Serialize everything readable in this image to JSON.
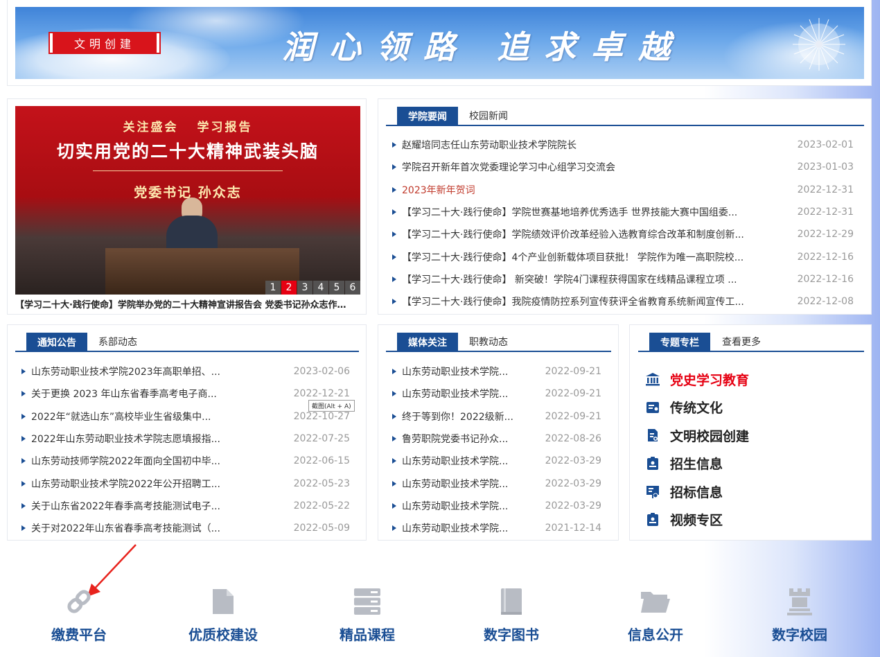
{
  "banner": {
    "badge": "文明创建",
    "slogan": "润心领路 追求卓越"
  },
  "slideshow": {
    "subtitle": "关注盛会 学习报告",
    "title": "切实用党的二十大精神武装头脑",
    "speaker": "党委书记 孙众志",
    "pages": [
      "1",
      "2",
      "3",
      "4",
      "5",
      "6"
    ],
    "active_page": "2",
    "caption": "【学习二十大·践行使命】学院举办党的二十大精神宣讲报告会 党委书记孙众志作专题..."
  },
  "college_news": {
    "tab_active": "学院要闻",
    "tab_other": "校园新闻",
    "items": [
      {
        "title": "赵耀培同志任山东劳动职业技术学院院长",
        "date": "2023-02-01"
      },
      {
        "title": "学院召开新年首次党委理论学习中心组学习交流会",
        "date": "2023-01-03"
      },
      {
        "title": "2023年新年贺词",
        "date": "2022-12-31"
      },
      {
        "title": "【学习二十大·践行使命】学院世赛基地培养优秀选手 世界技能大赛中国组委...",
        "date": "2022-12-31"
      },
      {
        "title": "【学习二十大·践行使命】学院绩效评价改革经验入选教育综合改革和制度创新...",
        "date": "2022-12-29"
      },
      {
        "title": "【学习二十大·践行使命】4个产业创新载体项目获批！ 学院作为唯一高职院校...",
        "date": "2022-12-16"
      },
      {
        "title": "【学习二十大·践行使命】 新突破！学院4门课程获得国家在线精品课程立项 ...",
        "date": "2022-12-16"
      },
      {
        "title": "【学习二十大·践行使命】我院疫情防控系列宣传获评全省教育系统新闻宣传工...",
        "date": "2022-12-08"
      }
    ]
  },
  "notices": {
    "tab_active": "通知公告",
    "tab_other": "系部动态",
    "items": [
      {
        "title": "山东劳动职业技术学院2023年高职单招、...",
        "date": "2023-02-06"
      },
      {
        "title": "关于更换 2023 年山东省春季高考电子商...",
        "date": "2022-12-21"
      },
      {
        "title": "2022年“就选山东”高校毕业生省级集中...",
        "date": "2022-10-27"
      },
      {
        "title": "2022年山东劳动职业技术学院志愿填报指...",
        "date": "2022-07-25"
      },
      {
        "title": "山东劳动技师学院2022年面向全国初中毕...",
        "date": "2022-06-15"
      },
      {
        "title": "山东劳动职业技术学院2022年公开招聘工...",
        "date": "2022-05-23"
      },
      {
        "title": "关于山东省2022年春季高考技能测试电子...",
        "date": "2022-05-22"
      },
      {
        "title": "关于对2022年山东省春季高考技能测试（...",
        "date": "2022-05-09"
      }
    ]
  },
  "media": {
    "tab_active": "媒体关注",
    "tab_other": "职教动态",
    "items": [
      {
        "title": "山东劳动职业技术学院...",
        "date": "2022-09-21"
      },
      {
        "title": "山东劳动职业技术学院...",
        "date": "2022-09-21"
      },
      {
        "title": "终于等到你！2022级新...",
        "date": "2022-09-21"
      },
      {
        "title": "鲁劳职院党委书记孙众...",
        "date": "2022-08-26"
      },
      {
        "title": "山东劳动职业技术学院...",
        "date": "2022-03-29"
      },
      {
        "title": "山东劳动职业技术学院...",
        "date": "2022-03-29"
      },
      {
        "title": "山东劳动职业技术学院...",
        "date": "2022-03-29"
      },
      {
        "title": "山东劳动职业技术学院...",
        "date": "2021-12-14"
      }
    ]
  },
  "topics": {
    "tab_active": "专题专栏",
    "tab_other": "查看更多",
    "items": [
      {
        "label": "党史学习教育",
        "icon": "bank-icon"
      },
      {
        "label": "传统文化",
        "icon": "certificate-icon"
      },
      {
        "label": "文明校园创建",
        "icon": "document-icon"
      },
      {
        "label": "招生信息",
        "icon": "badge-icon"
      },
      {
        "label": "招标信息",
        "icon": "presentation-icon"
      },
      {
        "label": "视频专区",
        "icon": "badge-icon"
      }
    ]
  },
  "tooltip": "截图(Alt + A)",
  "quick_links": [
    {
      "label": "缴费平台",
      "icon": "link-icon"
    },
    {
      "label": "优质校建设",
      "icon": "file-icon"
    },
    {
      "label": "精品课程",
      "icon": "server-icon"
    },
    {
      "label": "数字图书",
      "icon": "book-icon"
    },
    {
      "label": "信息公开",
      "icon": "folder-icon"
    },
    {
      "label": "数字校园",
      "icon": "chess-rook-icon"
    }
  ],
  "colors": {
    "primary": "#1a4e94",
    "highlight_red": "#e60012",
    "date_gray": "#999999"
  }
}
